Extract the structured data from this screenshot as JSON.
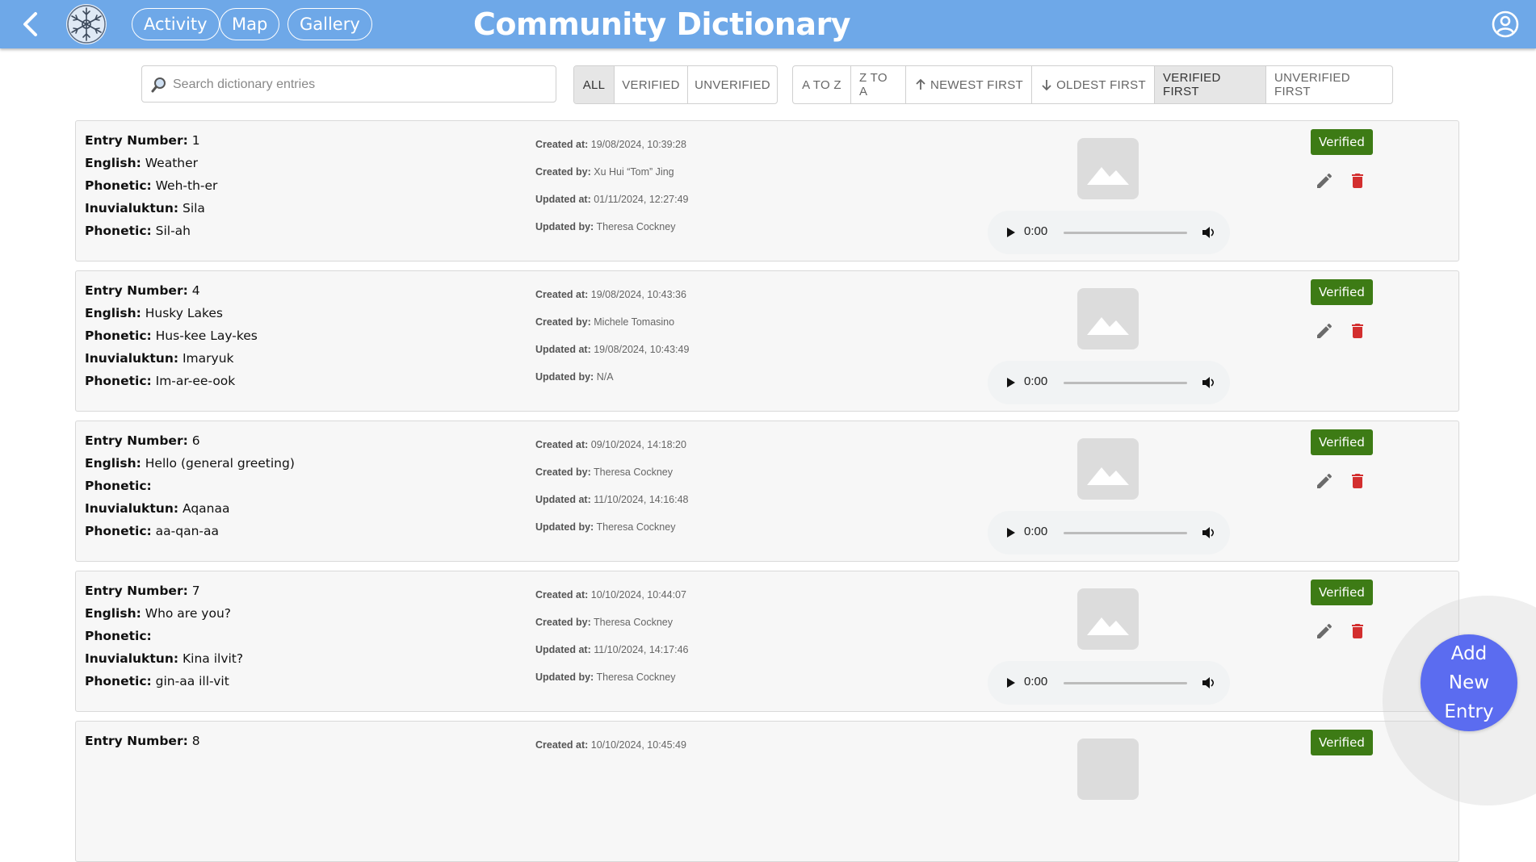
{
  "header": {
    "title": "Community Dictionary",
    "nav": [
      "Activity",
      "Map",
      "Gallery"
    ],
    "back_icon": "chevron-left-icon",
    "logo_icon": "snowflake-logo",
    "account_icon": "account-circle-icon",
    "background_color": "#6ea8e8"
  },
  "search": {
    "placeholder": "Search dictionary entries",
    "value": ""
  },
  "filters": {
    "options": [
      "ALL",
      "VERIFIED",
      "UNVERIFIED"
    ],
    "selected": "ALL"
  },
  "sort": {
    "options": [
      "A TO Z",
      "Z TO A",
      "NEWEST FIRST",
      "OLDEST FIRST",
      "VERIFIED FIRST",
      "UNVERIFIED FIRST"
    ],
    "selected": "VERIFIED FIRST"
  },
  "labels": {
    "entry_number": "Entry Number:",
    "english": "English:",
    "phonetic": "Phonetic:",
    "inuvialuktun": "Inuvialuktun:",
    "created_at": "Created at:",
    "created_by": "Created by:",
    "updated_at": "Updated at:",
    "updated_by": "Updated by:"
  },
  "entries": [
    {
      "number": "1",
      "english": "Weather",
      "phonetic_en": "Weh-th-er",
      "inuvialuktun": "Sila",
      "phonetic_in": "Sil-ah",
      "created_at": "19/08/2024, 10:39:28",
      "created_by": "Xu Hui “Tom” Jing",
      "updated_at": "01/11/2024, 12:27:49",
      "updated_by": "Theresa Cockney",
      "status": "Verified",
      "audio_time": "0:00"
    },
    {
      "number": "4",
      "english": "Husky Lakes",
      "phonetic_en": "Hus-kee Lay-kes",
      "inuvialuktun": "Imaryuk",
      "phonetic_in": "Im-ar-ee-ook",
      "created_at": "19/08/2024, 10:43:36",
      "created_by": "Michele Tomasino",
      "updated_at": "19/08/2024, 10:43:49",
      "updated_by": "N/A",
      "status": "Verified",
      "audio_time": "0:00"
    },
    {
      "number": "6",
      "english": "Hello (general greeting)",
      "phonetic_en": "",
      "inuvialuktun": "Aqanaa",
      "phonetic_in": "aa-qan-aa",
      "created_at": "09/10/2024, 14:18:20",
      "created_by": "Theresa Cockney",
      "updated_at": "11/10/2024, 14:16:48",
      "updated_by": "Theresa Cockney",
      "status": "Verified",
      "audio_time": "0:00"
    },
    {
      "number": "7",
      "english": "Who are you?",
      "phonetic_en": "",
      "inuvialuktun": "Kina ilvit?",
      "phonetic_in": "gin-aa ill-vit",
      "created_at": "10/10/2024, 10:44:07",
      "created_by": "Theresa Cockney",
      "updated_at": "11/10/2024, 14:17:46",
      "updated_by": "Theresa Cockney",
      "status": "Verified",
      "audio_time": "0:00"
    },
    {
      "number": "8",
      "created_at": "10/10/2024, 10:45:49",
      "status": "Verified"
    }
  ],
  "fab": {
    "label": "Add New Entry",
    "color": "#5b6cf0"
  },
  "colors": {
    "verified": "#3d7b15",
    "delete": "#d32f2f",
    "edit": "#6b6b6b"
  }
}
